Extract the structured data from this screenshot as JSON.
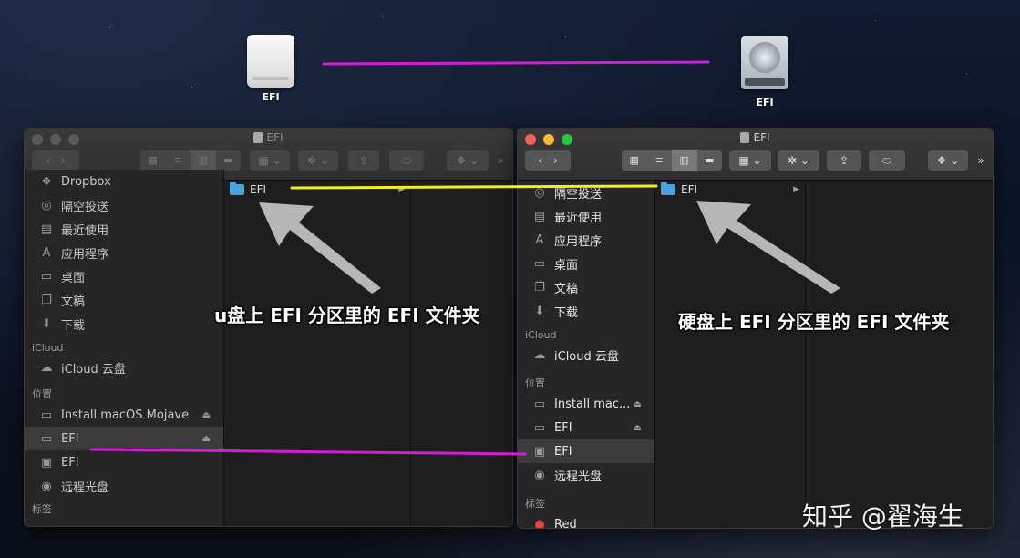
{
  "desktop": {
    "icons": [
      {
        "label": "EFI",
        "kind": "removable-drive"
      },
      {
        "label": "EFI",
        "kind": "hard-drive"
      }
    ]
  },
  "colors": {
    "magenta_line": "#d01fd0",
    "yellow_line": "#f0f020",
    "arrow": "#c8c8c8",
    "folder": "#4aa3df"
  },
  "left_window": {
    "title": "EFI",
    "sidebar": {
      "top_items": [
        {
          "icon": "dropbox-icon",
          "label": "Dropbox"
        },
        {
          "icon": "airdrop-icon",
          "label": "隔空投送"
        },
        {
          "icon": "recents-icon",
          "label": "最近使用"
        },
        {
          "icon": "applications-icon",
          "label": "应用程序"
        },
        {
          "icon": "desktop-icon",
          "label": "桌面"
        },
        {
          "icon": "documents-icon",
          "label": "文稿"
        },
        {
          "icon": "downloads-icon",
          "label": "下载"
        }
      ],
      "icloud_header": "iCloud",
      "icloud_items": [
        {
          "icon": "cloud-icon",
          "label": "iCloud 云盘"
        }
      ],
      "locations_header": "位置",
      "location_items": [
        {
          "icon": "disk-icon",
          "label": "Install macOS Mojave",
          "eject": true
        },
        {
          "icon": "disk-icon",
          "label": "EFI",
          "eject": true,
          "selected": true
        },
        {
          "icon": "harddisk-icon",
          "label": "EFI",
          "eject": false
        },
        {
          "icon": "optical-disc-icon",
          "label": "远程光盘",
          "eject": false
        }
      ],
      "tags_header": "标签"
    },
    "columns": [
      {
        "folder": "EFI"
      }
    ]
  },
  "right_window": {
    "title": "EFI",
    "sidebar": {
      "top_items": [
        {
          "icon": "airdrop-icon",
          "label": "隔空投送"
        },
        {
          "icon": "recents-icon",
          "label": "最近使用"
        },
        {
          "icon": "applications-icon",
          "label": "应用程序"
        },
        {
          "icon": "desktop-icon",
          "label": "桌面"
        },
        {
          "icon": "documents-icon",
          "label": "文稿"
        },
        {
          "icon": "downloads-icon",
          "label": "下载"
        }
      ],
      "icloud_header": "iCloud",
      "icloud_items": [
        {
          "icon": "cloud-icon",
          "label": "iCloud 云盘"
        }
      ],
      "locations_header": "位置",
      "location_items": [
        {
          "icon": "disk-icon",
          "label": "Install mac...",
          "eject": true
        },
        {
          "icon": "disk-icon",
          "label": "EFI",
          "eject": true
        },
        {
          "icon": "harddisk-icon",
          "label": "EFI",
          "eject": false,
          "selected": true
        },
        {
          "icon": "optical-disc-icon",
          "label": "远程光盘",
          "eject": false
        }
      ],
      "tags_header": "标签",
      "tag_items": [
        {
          "color": "#e0443e",
          "label": "Red"
        }
      ]
    },
    "columns": [
      {
        "folder": "EFI"
      }
    ]
  },
  "annotations": {
    "left": "u盘上 EFI 分区里的 EFI 文件夹",
    "right": "硬盘上 EFI 分区里的 EFI 文件夹"
  },
  "watermark": "知乎 @翟海生"
}
